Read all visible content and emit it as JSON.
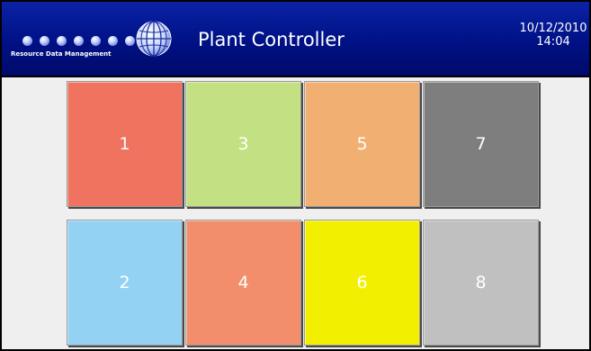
{
  "header": {
    "logo_text": "Resource Data Management",
    "title": "Plant Controller",
    "date": "10/12/2010",
    "time": "14:04"
  },
  "tiles": [
    {
      "label": "1",
      "color": "#f07360"
    },
    {
      "label": "3",
      "color": "#c3e082"
    },
    {
      "label": "5",
      "color": "#f1b072"
    },
    {
      "label": "7",
      "color": "#7e7e7e"
    },
    {
      "label": "2",
      "color": "#93d2f2"
    },
    {
      "label": "4",
      "color": "#f28e6c"
    },
    {
      "label": "6",
      "color": "#f2f000"
    },
    {
      "label": "8",
      "color": "#c0c0c0"
    }
  ],
  "colors": {
    "header_bg": "#00128a",
    "page_bg": "#efefef"
  }
}
